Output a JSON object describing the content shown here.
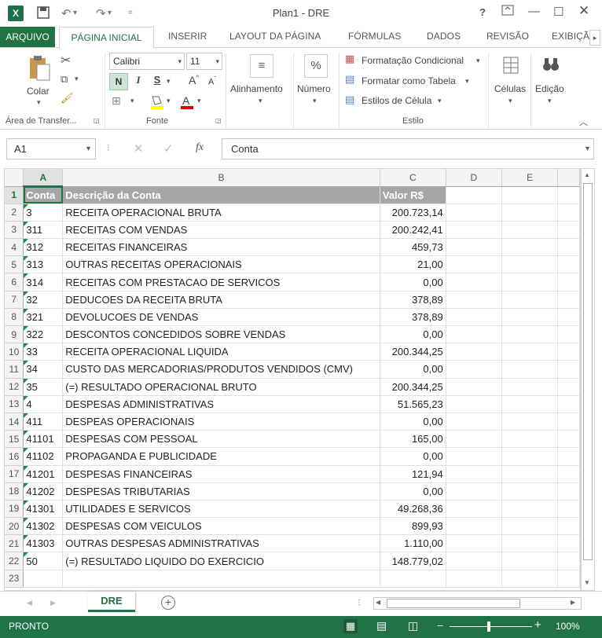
{
  "window": {
    "title": "Plan1 - DRE",
    "help": "?",
    "app_icon": "X"
  },
  "tabs": [
    "ARQUIVO",
    "PÁGINA INICIAL",
    "INSERIR",
    "LAYOUT DA PÁGINA",
    "FÓRMULAS",
    "DADOS",
    "REVISÃO",
    "EXIBIÇÃ"
  ],
  "ribbon": {
    "paste": "Colar",
    "clipboard_group": "Área de Transfer...",
    "font_name": "Calibri",
    "font_size": "11",
    "bold": "N",
    "italic": "I",
    "underline": "S",
    "grow": "A",
    "shrink": "A",
    "font_group": "Fonte",
    "alignment": "Alinhamento",
    "number": "Número",
    "percent": "%",
    "cond_format": "Formatação Condicional",
    "format_table": "Formatar como Tabela",
    "cell_styles": "Estilos de Célula",
    "style_group": "Estilo",
    "cells": "Células",
    "edit": "Edição"
  },
  "formula_bar": {
    "name_box": "A1",
    "fx": "fx",
    "value": "Conta"
  },
  "columns": [
    "A",
    "B",
    "C",
    "D",
    "E"
  ],
  "header_row": {
    "conta": "Conta",
    "descricao": "Descrição da Conta",
    "valor": "Valor R$"
  },
  "rows": [
    {
      "n": "2",
      "conta": "3",
      "desc": "RECEITA OPERACIONAL BRUTA",
      "valor": "200.723,14"
    },
    {
      "n": "3",
      "conta": "311",
      "desc": "RECEITAS COM VENDAS",
      "valor": "200.242,41"
    },
    {
      "n": "4",
      "conta": "312",
      "desc": "RECEITAS FINANCEIRAS",
      "valor": "459,73"
    },
    {
      "n": "5",
      "conta": "313",
      "desc": "OUTRAS RECEITAS OPERACIONAIS",
      "valor": "21,00"
    },
    {
      "n": "6",
      "conta": "314",
      "desc": "RECEITAS COM PRESTACAO DE SERVICOS",
      "valor": "0,00"
    },
    {
      "n": "7",
      "conta": "32",
      "desc": "DEDUCOES DA RECEITA BRUTA",
      "valor": "378,89"
    },
    {
      "n": "8",
      "conta": "321",
      "desc": "DEVOLUCOES DE VENDAS",
      "valor": "378,89"
    },
    {
      "n": "9",
      "conta": "322",
      "desc": "DESCONTOS CONCEDIDOS SOBRE VENDAS",
      "valor": "0,00"
    },
    {
      "n": "10",
      "conta": "33",
      "desc": "RECEITA OPERACIONAL LIQUIDA",
      "valor": "200.344,25"
    },
    {
      "n": "11",
      "conta": "34",
      "desc": "CUSTO DAS MERCADORIAS/PRODUTOS VENDIDOS (CMV)",
      "valor": "0,00"
    },
    {
      "n": "12",
      "conta": "35",
      "desc": "(=) RESULTADO OPERACIONAL BRUTO",
      "valor": "200.344,25"
    },
    {
      "n": "13",
      "conta": "4",
      "desc": "DESPESAS ADMINISTRATIVAS",
      "valor": "51.565,23"
    },
    {
      "n": "14",
      "conta": "411",
      "desc": "DESPEAS OPERACIONAIS",
      "valor": "0,00"
    },
    {
      "n": "15",
      "conta": "41101",
      "desc": "DESPESAS COM PESSOAL",
      "valor": "165,00"
    },
    {
      "n": "16",
      "conta": "41102",
      "desc": "PROPAGANDA E PUBLICIDADE",
      "valor": "0,00"
    },
    {
      "n": "17",
      "conta": "41201",
      "desc": "DESPESAS FINANCEIRAS",
      "valor": "121,94"
    },
    {
      "n": "18",
      "conta": "41202",
      "desc": "DESPESAS TRIBUTARIAS",
      "valor": "0,00"
    },
    {
      "n": "19",
      "conta": "41301",
      "desc": "UTILIDADES E SERVICOS",
      "valor": "49.268,36"
    },
    {
      "n": "20",
      "conta": "41302",
      "desc": "DESPESAS COM VEICULOS",
      "valor": "899,93"
    },
    {
      "n": "21",
      "conta": "41303",
      "desc": "OUTRAS DESPESAS ADMINISTRATIVAS",
      "valor": "1.110,00"
    },
    {
      "n": "22",
      "conta": "50",
      "desc": "(=) RESULTADO LIQUIDO DO EXERCICIO",
      "valor": "148.779,02"
    },
    {
      "n": "23",
      "conta": "",
      "desc": "",
      "valor": ""
    }
  ],
  "sheet_tab": "DRE",
  "status": {
    "text": "PRONTO",
    "zoom": "100%"
  },
  "colors": {
    "accent": "#217346",
    "header_fill": "#a6a6a6"
  }
}
